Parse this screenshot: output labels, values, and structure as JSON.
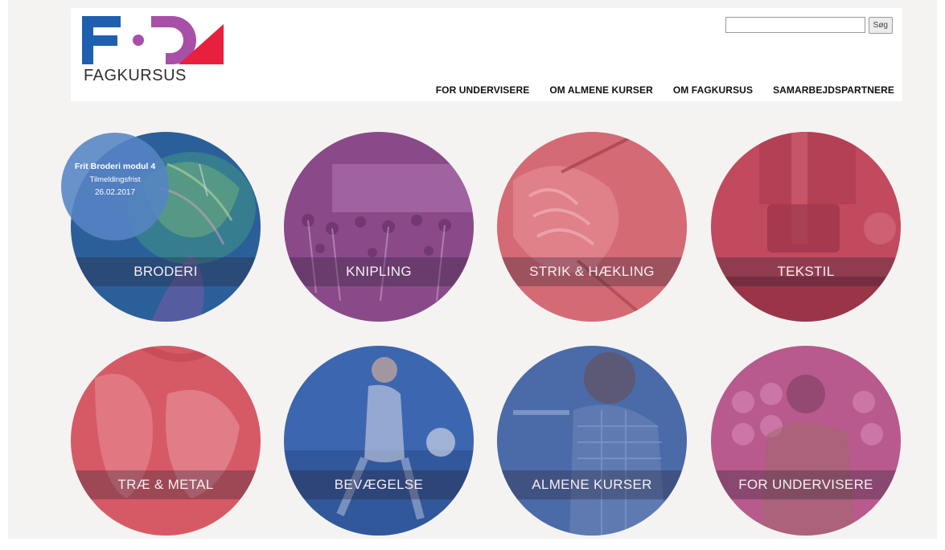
{
  "header": {
    "logo_text": "FAGKURSUS",
    "search": {
      "placeholder": "",
      "button_label": "Søg"
    },
    "nav": [
      {
        "label": "FOR UNDERVISERE"
      },
      {
        "label": "OM ALMENE KURSER"
      },
      {
        "label": "OM FAGKURSUS"
      },
      {
        "label": "SAMARBEJDSPARTNERE"
      }
    ]
  },
  "badge": {
    "title": "Frit Broderi modul 4",
    "subtitle": "Tilmeldingsfrist",
    "date": "26.02.2017"
  },
  "tiles": [
    {
      "label": "BRODERI"
    },
    {
      "label": "KNIPLING"
    },
    {
      "label": "STRIK & HÆKLING"
    },
    {
      "label": "TEKSTIL"
    },
    {
      "label": "TRÆ & METAL"
    },
    {
      "label": "BEVÆGELSE"
    },
    {
      "label": "ALMENE KURSER"
    },
    {
      "label": "FOR UNDERVISERE"
    }
  ],
  "colors": {
    "logo_blue": "#1f5fb0",
    "logo_purple": "#a84fa8",
    "logo_red": "#e8203e",
    "tint_blue": "#2b5f9a",
    "tint_purple": "#8a4a8a",
    "tint_pink": "#d46a74",
    "tint_magenta": "#b85a8e"
  }
}
